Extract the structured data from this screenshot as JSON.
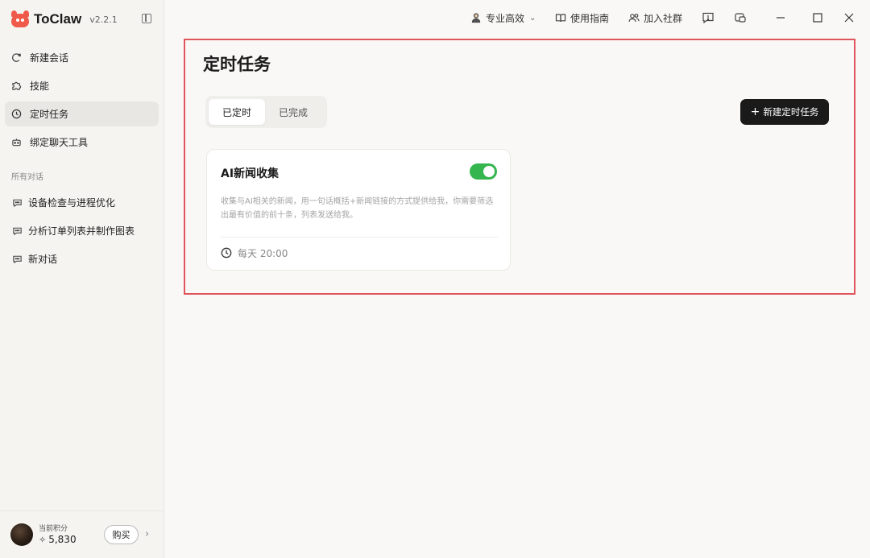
{
  "app": {
    "name": "ToClaw",
    "version": "v2.2.1"
  },
  "sidebar": {
    "nav": [
      {
        "label": "新建会话",
        "icon": "new-chat-icon"
      },
      {
        "label": "技能",
        "icon": "puzzle-icon"
      },
      {
        "label": "定时任务",
        "icon": "clock-icon",
        "active": true
      },
      {
        "label": "绑定聊天工具",
        "icon": "bot-icon"
      }
    ],
    "section_label": "所有对话",
    "chats": [
      {
        "label": "设备检查与进程优化",
        "icon": "chat-icon"
      },
      {
        "label": "分析订单列表并制作图表",
        "icon": "chat-icon"
      },
      {
        "label": "新对话",
        "icon": "chat-icon"
      }
    ],
    "account": {
      "points_label": "当前积分",
      "points_value": "5,830",
      "buy_label": "购买"
    }
  },
  "topbar": {
    "mode_label": "专业高效",
    "guide_label": "使用指南",
    "community_label": "加入社群"
  },
  "main": {
    "title": "定时任务",
    "tabs": [
      {
        "label": "已定时",
        "active": true
      },
      {
        "label": "已完成",
        "active": false
      }
    ],
    "new_task_label": "新建定时任务",
    "tasks": [
      {
        "title": "AI新闻收集",
        "enabled": true,
        "description": "收集与AI相关的新闻，用一句话概括+新闻链接的方式提供给我，你需要筛选出最有价值的前十条，列表发送给我。",
        "schedule": "每天 20:00"
      }
    ]
  },
  "colors": {
    "accent_green": "#35b54d",
    "highlight_red": "#e0555c",
    "brand_red": "#ef5a4a"
  }
}
